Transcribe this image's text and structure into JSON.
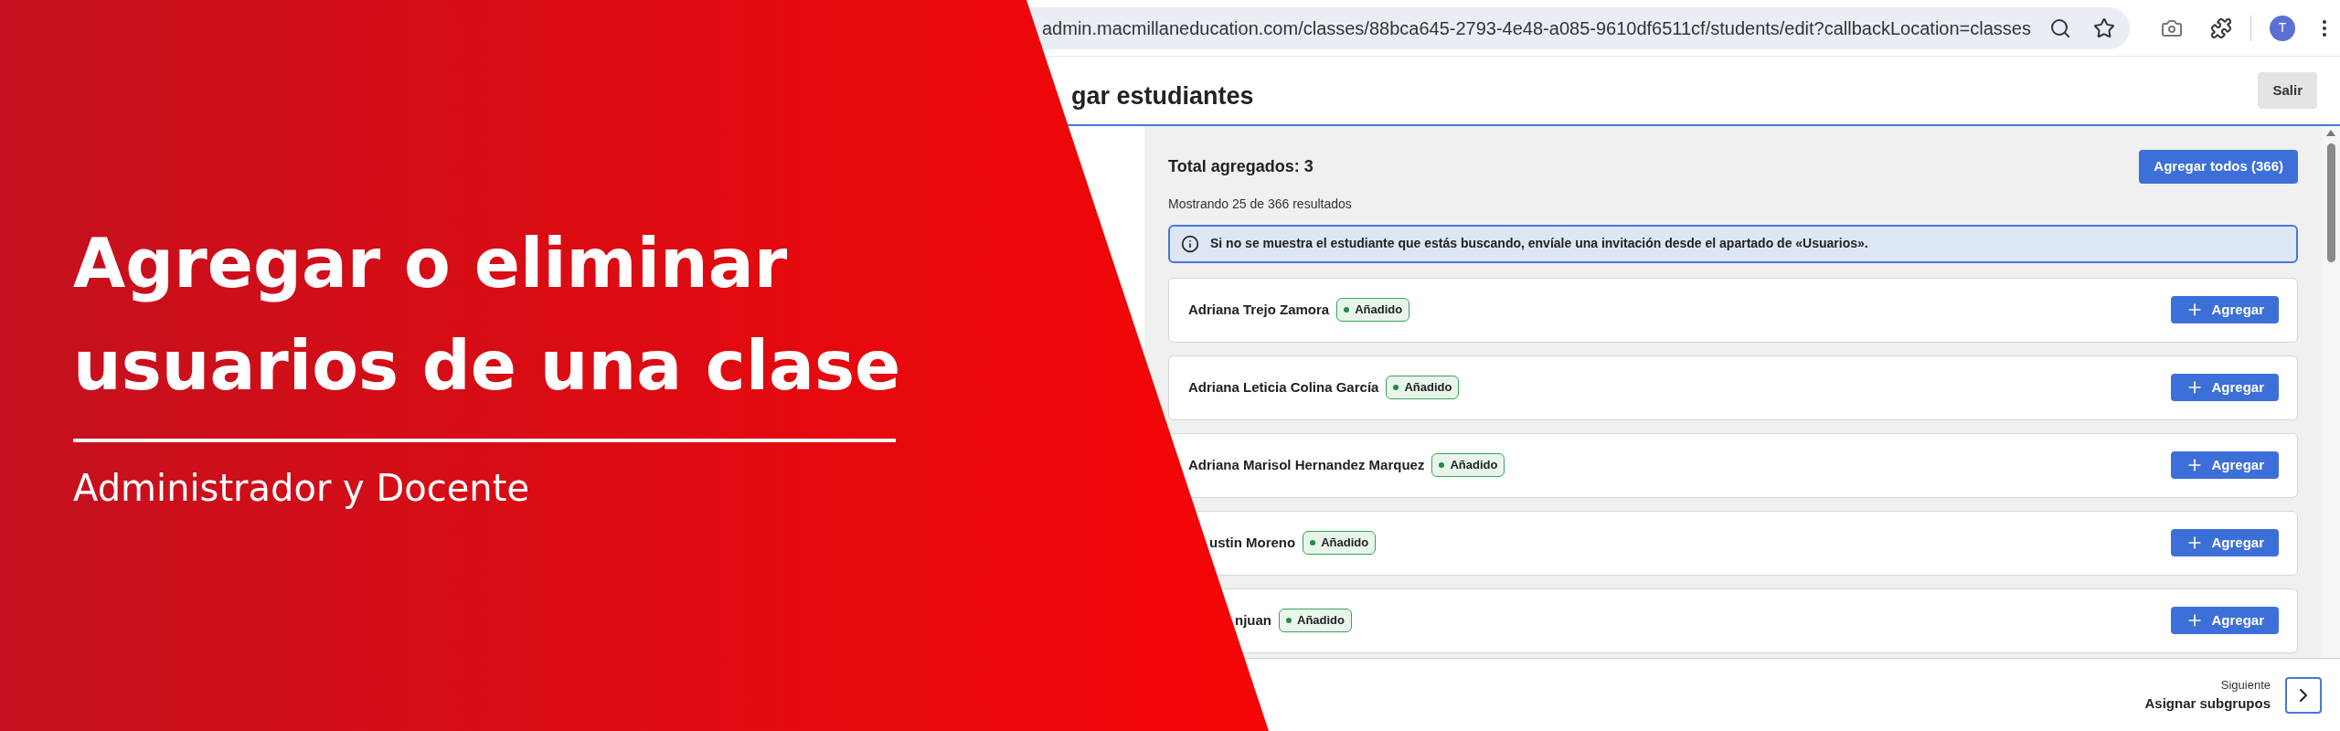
{
  "banner": {
    "title_lines": [
      "Agregar o eliminar",
      "usuarios de una clase"
    ],
    "subtitle": "Administrador y Docente"
  },
  "browser": {
    "url": "admin.macmillaneducation.com/classes/88bca645-2793-4e48-a085-9610df6511cf/students/edit?callbackLocation=classes",
    "avatar": "T"
  },
  "header": {
    "title": "gar estudiantes",
    "exit_button": "Salir"
  },
  "summary": {
    "total": "Total agregados: 3",
    "add_all_button": "Agregar todos (366)",
    "showing": "Mostrando 25 de 366 resultados"
  },
  "info": "Si no se muestra el estudiante que estás buscando, envíale una invitación desde el apartado de «Usuarios».",
  "students": [
    {
      "name": "Adriana Trejo Zamora",
      "badge": "Añadido",
      "button": "Agregar"
    },
    {
      "name": "Adriana Leticia Colina García",
      "badge": "Añadido",
      "button": "Agregar"
    },
    {
      "name": "Adriana Marisol Hernandez Marquez",
      "badge": "Añadido",
      "button": "Agregar"
    },
    {
      "name": "ustin Moreno",
      "badge": "Añadido",
      "button": "Agregar"
    },
    {
      "name": "njuan",
      "badge": "Añadido",
      "button": "Agregar"
    }
  ],
  "footer": {
    "caption": "Siguiente",
    "next_step": "Asignar subgrupos"
  }
}
